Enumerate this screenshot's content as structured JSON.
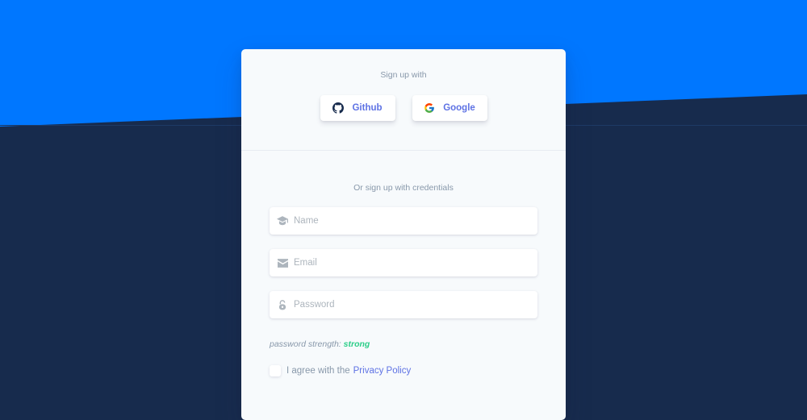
{
  "header": {
    "signup_with": "Sign up with",
    "buttons": [
      {
        "label": "Github",
        "icon": "github-icon"
      },
      {
        "label": "Google",
        "icon": "google-icon"
      }
    ]
  },
  "form": {
    "credentials_text": "Or sign up with credentials",
    "name": {
      "placeholder": "Name",
      "value": "",
      "icon": "graduation-cap-icon"
    },
    "email": {
      "placeholder": "Email",
      "value": "",
      "icon": "envelope-icon"
    },
    "password": {
      "placeholder": "Password",
      "value": "",
      "icon": "lock-icon"
    },
    "strength_label": "password strength:",
    "strength_value": "strong",
    "agree_text": "I agree with the",
    "privacy_link": "Privacy Policy"
  },
  "colors": {
    "top_background": "#0077ff",
    "bottom_background": "#172b4d",
    "accent": "#5e72e4",
    "success": "#2dce89"
  }
}
